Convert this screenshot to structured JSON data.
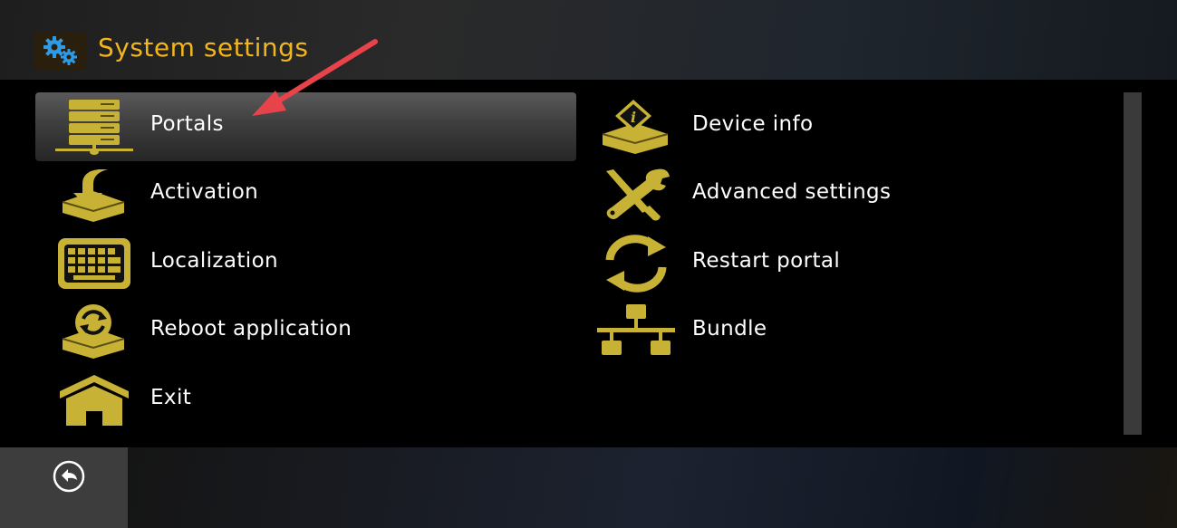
{
  "header": {
    "title": "System settings",
    "icon": "gears-icon"
  },
  "colors": {
    "accent": "#f2b51c",
    "icon_gold": "#c8b235",
    "arrow": "#e8424a"
  },
  "menu": {
    "left": [
      {
        "label": "Portals",
        "icon": "server-network-icon",
        "selected": true
      },
      {
        "label": "Activation",
        "icon": "download-device-icon"
      },
      {
        "label": "Localization",
        "icon": "keyboard-icon"
      },
      {
        "label": "Reboot application",
        "icon": "reboot-device-icon"
      },
      {
        "label": "Exit",
        "icon": "home-icon"
      }
    ],
    "right": [
      {
        "label": "Device info",
        "icon": "info-device-icon"
      },
      {
        "label": "Advanced settings",
        "icon": "wrench-screwdriver-icon"
      },
      {
        "label": "Restart portal",
        "icon": "restart-arrows-icon"
      },
      {
        "label": "Bundle",
        "icon": "network-hierarchy-icon"
      }
    ]
  },
  "footer": {
    "back_icon": "back-arrow-icon"
  }
}
